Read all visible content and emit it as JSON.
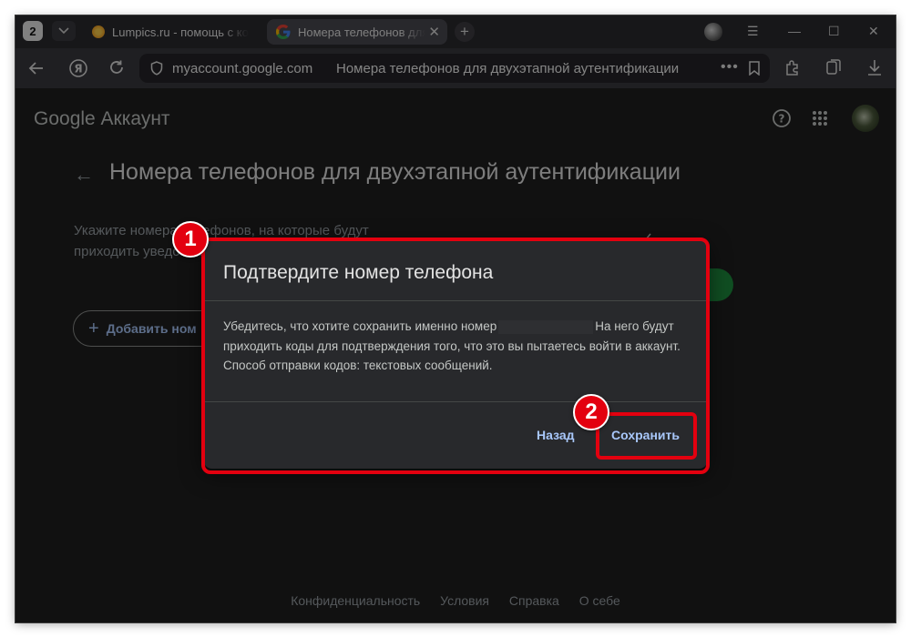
{
  "browser": {
    "tab_count": "2",
    "tabs": [
      {
        "title": "Lumpics.ru - помощь с ко",
        "icon": "lumpics-favicon"
      },
      {
        "title": "Номера телефонов для",
        "icon": "google-favicon"
      }
    ],
    "address": {
      "domain": "myaccount.google.com",
      "page_title": "Номера телефонов для двухэтапной аутентификации"
    }
  },
  "page": {
    "brand": "Google Аккаунт",
    "title": "Номера телефонов для двухэтапной аутентификации",
    "description": "Укажите номера телефонов, на которые будут приходить уведомления и коды для входа.",
    "add_button": "Добавить ном",
    "footer": [
      "Конфиденциальность",
      "Условия",
      "Справка",
      "О себе"
    ]
  },
  "dialog": {
    "title": "Подтвердите номер телефона",
    "body_before": "Убедитесь, что хотите сохранить именно номер",
    "body_after": "На него будут приходить коды для подтверждения того, что это вы пытаетесь войти в аккаунт. Способ отправки кодов: текстовых сообщений.",
    "back_label": "Назад",
    "save_label": "Сохранить"
  },
  "annotations": {
    "step1": "1",
    "step2": "2"
  },
  "colors": {
    "accent": "#a8c7fa",
    "highlight": "#e3000f",
    "background": "#1f1f1f"
  }
}
